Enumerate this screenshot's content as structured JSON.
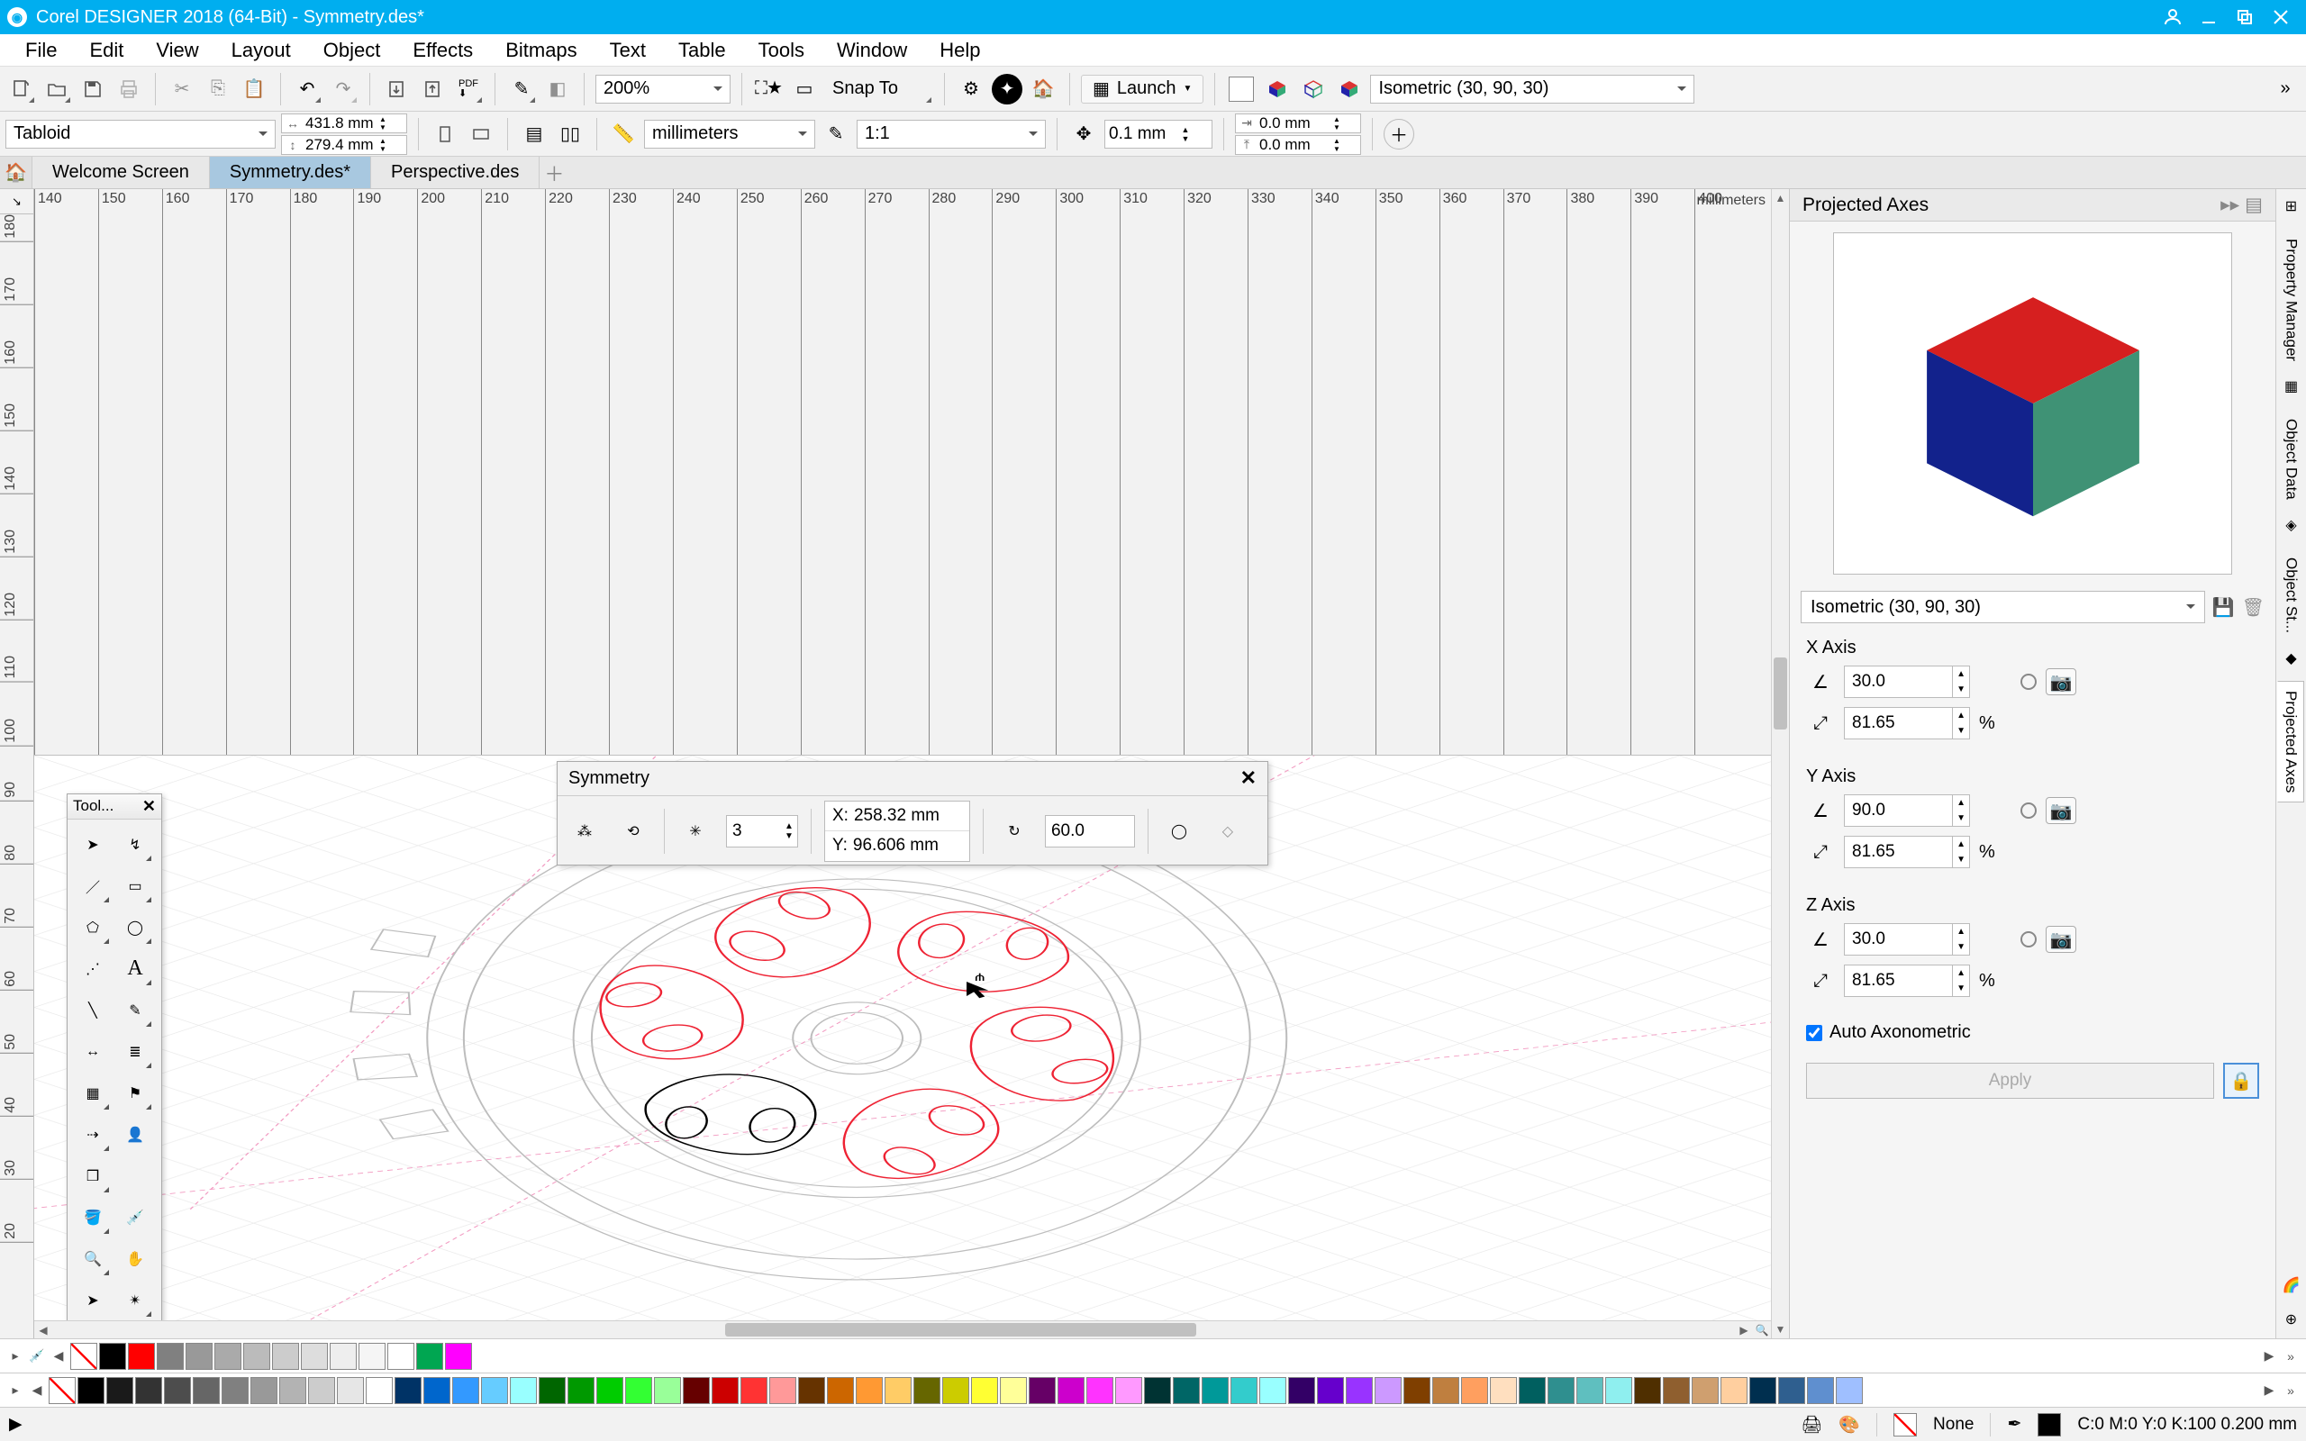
{
  "title": "Corel DESIGNER 2018 (64-Bit) - Symmetry.des*",
  "menu": [
    "File",
    "Edit",
    "View",
    "Layout",
    "Object",
    "Effects",
    "Bitmaps",
    "Text",
    "Table",
    "Tools",
    "Window",
    "Help"
  ],
  "toolbar1": {
    "zoom": "200%",
    "snapto": "Snap To",
    "launch": "Launch",
    "projection": "Isometric (30, 90, 30)"
  },
  "propbar": {
    "pagesize": "Tabloid",
    "width": "431.8 mm",
    "height": "279.4 mm",
    "units": "millimeters",
    "ratio": "1:1",
    "nudge": "0.1 mm",
    "dup_x": "0.0 mm",
    "dup_y": "0.0 mm"
  },
  "doctabs": {
    "welcome": "Welcome Screen",
    "active": "Symmetry.des*",
    "other": "Perspective.des"
  },
  "ruler": {
    "units": "millimeters",
    "top_ticks": [
      140,
      150,
      160,
      170,
      180,
      190,
      200,
      210,
      220,
      230,
      240,
      250,
      260,
      270,
      280,
      290,
      300,
      310,
      320,
      330,
      340,
      350,
      360,
      370,
      380,
      390,
      400
    ],
    "left_ticks": [
      180,
      170,
      160,
      150,
      140,
      130,
      120,
      110,
      100,
      90,
      80,
      70,
      60,
      50,
      40,
      30,
      20
    ],
    "corner": "↖"
  },
  "toolbox": {
    "title": "Tool..."
  },
  "symmetry": {
    "title": "Symmetry",
    "lines": "3",
    "x_label": "X:",
    "y_label": "Y:",
    "x": "258.32 mm",
    "y": "96.606 mm",
    "angle": "60.0"
  },
  "docker": {
    "title": "Projected Axes",
    "preset": "Isometric (30, 90, 30)",
    "x_axis": "X Axis",
    "y_axis": "Y Axis",
    "z_axis": "Z Axis",
    "x_angle": "30.0",
    "x_scale": "81.65",
    "y_angle": "90.0",
    "y_scale": "81.65",
    "z_angle": "30.0",
    "z_scale": "81.65",
    "pct": "%",
    "auto": "Auto Axonometric",
    "apply": "Apply"
  },
  "side_tabs": [
    "Property Manager",
    "Object Data",
    "Object St...",
    "Projected Axes"
  ],
  "status": {
    "cursor_hint": "▶",
    "pen_icon": "✒",
    "fill_label": "None",
    "color_readout": "C:0 M:0 Y:0 K:100  0.200 mm"
  },
  "palette1": [
    "#000000",
    "#ff0000",
    "#808080",
    "#999999",
    "#aaaaaa",
    "#bbbbbb",
    "#cccccc",
    "#dddddd",
    "#eeeeee",
    "#f5f5f5",
    "#ffffff",
    "#00a651",
    "#ff00ff"
  ],
  "palette2": [
    "#000000",
    "#1a1a1a",
    "#333333",
    "#4d4d4d",
    "#666666",
    "#808080",
    "#999999",
    "#b3b3b3",
    "#cccccc",
    "#e6e6e6",
    "#ffffff",
    "#003366",
    "#0066cc",
    "#3399ff",
    "#66ccff",
    "#99ffff",
    "#006600",
    "#009900",
    "#00cc00",
    "#33ff33",
    "#99ff99",
    "#660000",
    "#cc0000",
    "#ff3333",
    "#ff9999",
    "#663300",
    "#cc6600",
    "#ff9933",
    "#ffcc66",
    "#666600",
    "#cccc00",
    "#ffff33",
    "#ffff99",
    "#660066",
    "#cc00cc",
    "#ff33ff",
    "#ff99ff",
    "#003333",
    "#006666",
    "#009999",
    "#33cccc",
    "#99ffff",
    "#330066",
    "#6600cc",
    "#9933ff",
    "#cc99ff",
    "#7f3f00",
    "#bf7f3f",
    "#ff9f5f",
    "#ffdfbf",
    "#005f5f",
    "#2f8f8f",
    "#5fbfbf",
    "#8fefef",
    "#4f2f00",
    "#8f5f2f",
    "#cf9f6f",
    "#ffcf9f",
    "#002f4f",
    "#2f5f8f",
    "#5f8fcf",
    "#9fbfff"
  ]
}
